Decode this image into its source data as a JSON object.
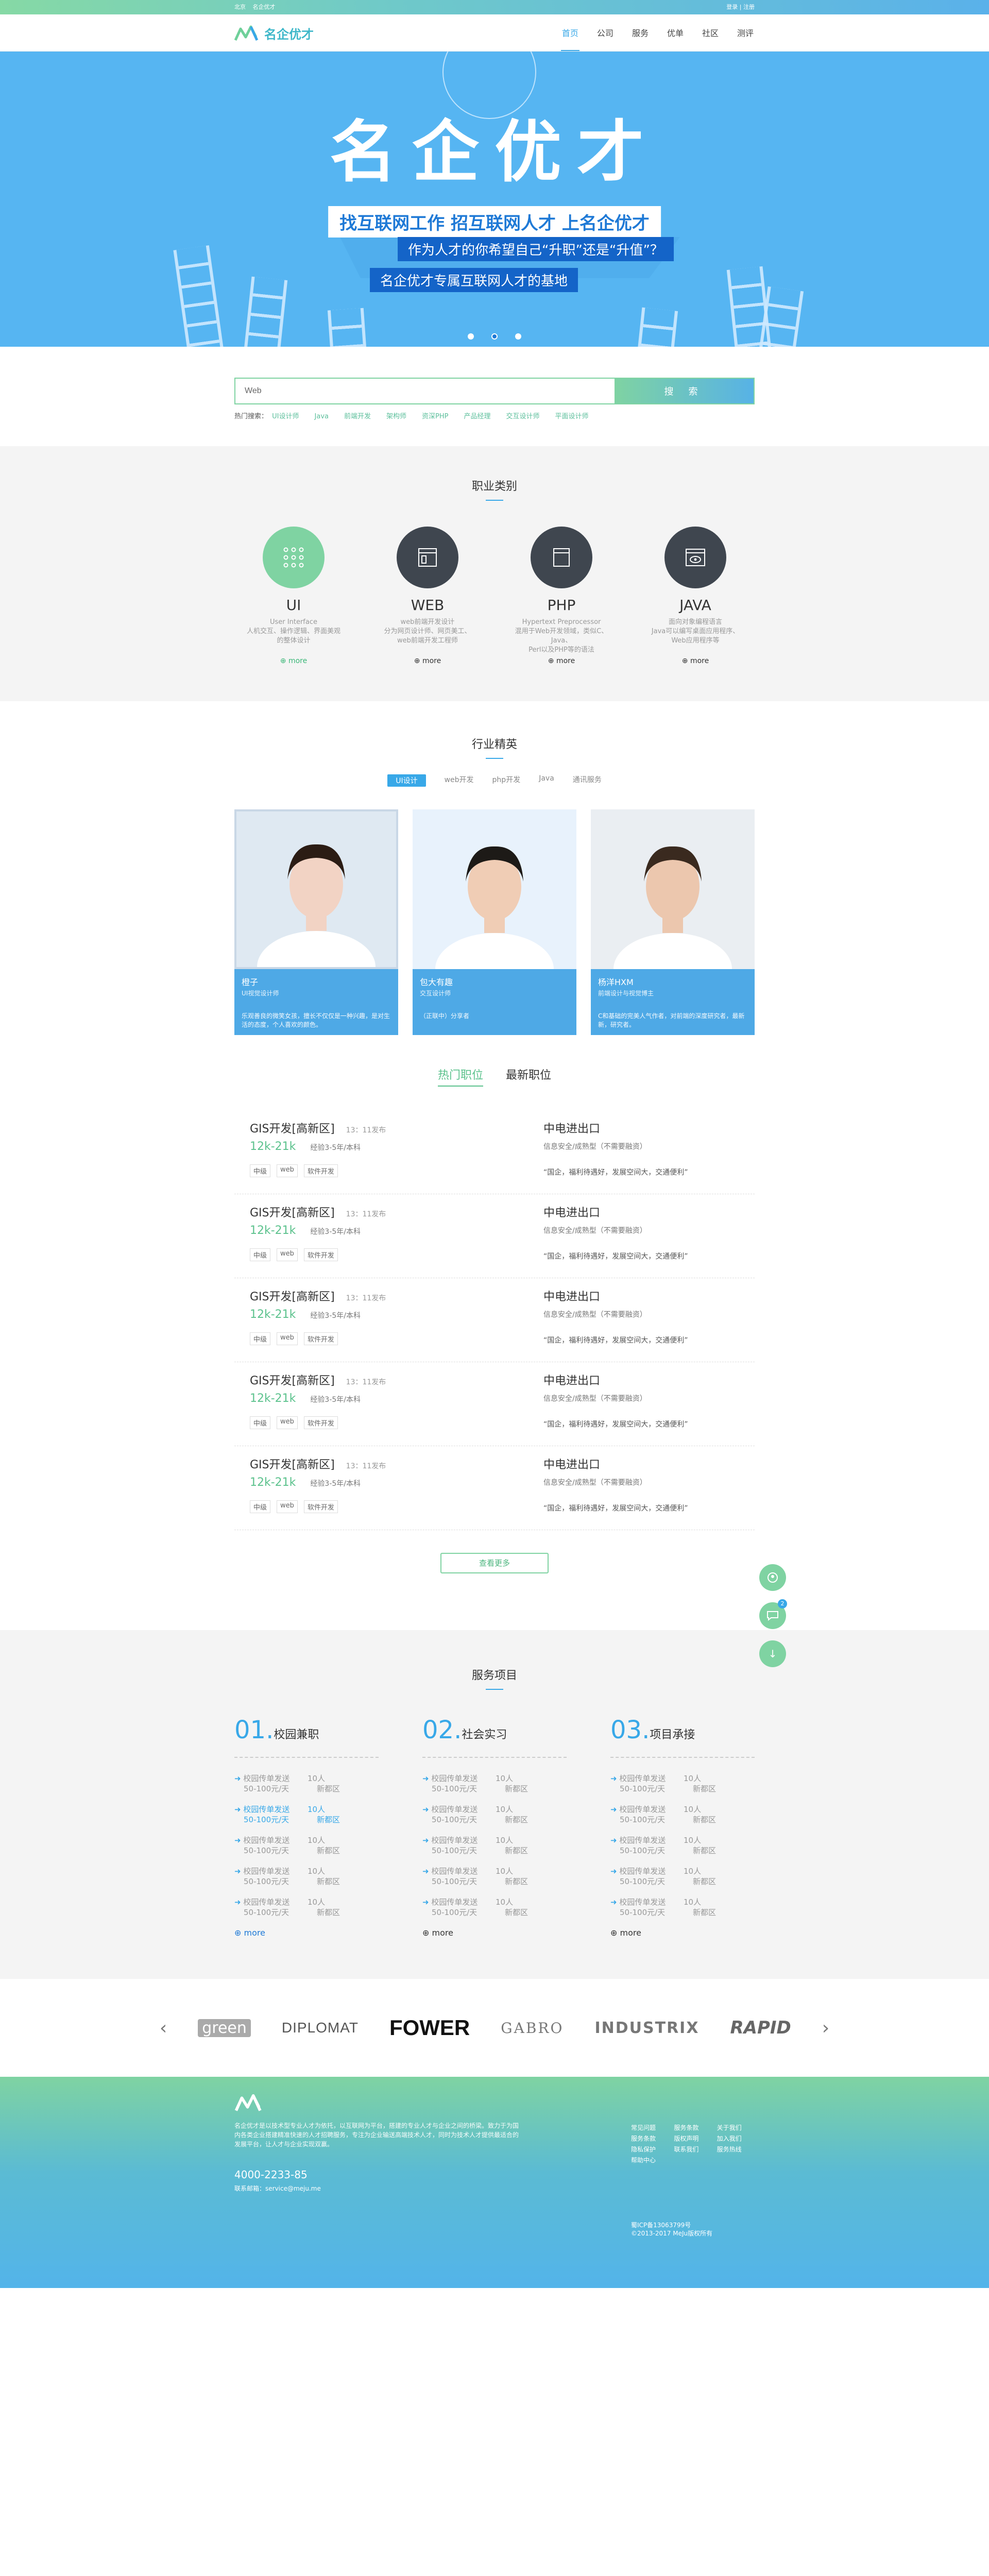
{
  "topbar": {
    "location": "北京",
    "site_tag": "名企优才",
    "login": "登录",
    "separator": "|",
    "register": "注册"
  },
  "header": {
    "logo_text": "名企优才",
    "nav": [
      "首页",
      "公司",
      "服务",
      "优单",
      "社区",
      "测评"
    ],
    "active_nav": "首页"
  },
  "banner": {
    "title": "名企优才",
    "line1": "找互联网工作  招互联网人才  上名企优才",
    "line2": "作为人才的你希望自己“升职”还是“升值”？",
    "line3": "名企优才专属互联网人才的基地",
    "slides": 3,
    "active_slide": 1
  },
  "search": {
    "value": "Web",
    "button": "搜 索",
    "hot_label": "热门搜索：",
    "hot_keywords": [
      "UI设计师",
      "Java",
      "前端开发",
      "架构师",
      "资深PHP",
      "产品经理",
      "交互设计师",
      "平面设计师"
    ]
  },
  "categories": {
    "title": "职业类别",
    "items": [
      {
        "name": "UI",
        "desc": "User Interface\n人机交互、操作逻辑、界面美观\n的整体设计",
        "more": "more",
        "icon": "grid-dots-icon"
      },
      {
        "name": "WEB",
        "desc": "web前端开发设计\n分为网页设计师、网页美工、\nweb前端开发工程师",
        "more": "more",
        "icon": "webpage-icon"
      },
      {
        "name": "PHP",
        "desc": "Hypertext Preprocessor\n混用于Web开发领域，类似C、Java、\nPerl以及PHP等的语法",
        "more": "more",
        "icon": "document-icon"
      },
      {
        "name": "JAVA",
        "desc": "面向对象编程语言\nJava可以编写桌面应用程序、\nWeb应用程序等",
        "more": "more",
        "icon": "eye-browser-icon"
      }
    ]
  },
  "elite": {
    "title": "行业精英",
    "tabs": [
      "UI设计",
      "web开发",
      "php开发",
      "Java",
      "通讯服务"
    ],
    "active_tab": "UI设计",
    "people": [
      {
        "name": "橙子",
        "role": "UI视觉设计师",
        "desc": "乐观善良的微笑女孩，擅长不仅仅是一种兴趣，是对生活的态度，个人喜欢的颜色。"
      },
      {
        "name": "包大有趣",
        "role": "交互设计师",
        "desc": "（正联中）分享者"
      },
      {
        "name": "杨洋HXM",
        "role": "前端设计与视觉博主",
        "desc": "C和基础的完美人气作者，对前端的深度研究者，最新新，研究者。"
      }
    ]
  },
  "jobs": {
    "tabs": [
      "热门职位",
      "最新职位"
    ],
    "active_tab": "热门职位",
    "items": [
      {
        "title": "GIS开发[高新区]",
        "time": "13：11发布",
        "salary": "12k-21k",
        "req": "经验3-5年/本科",
        "tags": [
          "中级",
          "web",
          "软件开发"
        ],
        "company": "中电进出口",
        "industry": "信息安全/成熟型（不需要融资）",
        "slogan": "“国企，福利待遇好，发展空间大，交通便利”"
      },
      {
        "title": "GIS开发[高新区]",
        "time": "13：11发布",
        "salary": "12k-21k",
        "req": "经验3-5年/本科",
        "tags": [
          "中级",
          "web",
          "软件开发"
        ],
        "company": "中电进出口",
        "industry": "信息安全/成熟型（不需要融资）",
        "slogan": "“国企，福利待遇好，发展空间大，交通便利”"
      },
      {
        "title": "GIS开发[高新区]",
        "time": "13：11发布",
        "salary": "12k-21k",
        "req": "经验3-5年/本科",
        "tags": [
          "中级",
          "web",
          "软件开发"
        ],
        "company": "中电进出口",
        "industry": "信息安全/成熟型（不需要融资）",
        "slogan": "“国企，福利待遇好，发展空间大，交通便利”"
      },
      {
        "title": "GIS开发[高新区]",
        "time": "13：11发布",
        "salary": "12k-21k",
        "req": "经验3-5年/本科",
        "tags": [
          "中级",
          "web",
          "软件开发"
        ],
        "company": "中电进出口",
        "industry": "信息安全/成熟型（不需要融资）",
        "slogan": "“国企，福利待遇好，发展空间大，交通便利”"
      },
      {
        "title": "GIS开发[高新区]",
        "time": "13：11发布",
        "salary": "12k-21k",
        "req": "经验3-5年/本科",
        "tags": [
          "中级",
          "web",
          "软件开发"
        ],
        "company": "中电进出口",
        "industry": "信息安全/成熟型（不需要融资）",
        "slogan": "“国企，福利待遇好，发展空间大，交通便利”"
      }
    ],
    "more": "查看更多"
  },
  "side_float": {
    "badge": "2",
    "buttons": [
      "qq-icon",
      "chat-icon",
      "download-icon"
    ],
    "top_label": "↓"
  },
  "services": {
    "title": "服务项目",
    "columns": [
      {
        "num": "01.",
        "name": "校园兼职",
        "items": [
          {
            "a": "校园传单发送",
            "b": "50-100元/天",
            "c": "10人",
            "d": "新都区"
          },
          {
            "a": "校园传单发送",
            "b": "50-100元/天",
            "c": "10人",
            "d": "新都区",
            "hl": true
          },
          {
            "a": "校园传单发送",
            "b": "50-100元/天",
            "c": "10人",
            "d": "新都区"
          },
          {
            "a": "校园传单发送",
            "b": "50-100元/天",
            "c": "10人",
            "d": "新都区"
          },
          {
            "a": "校园传单发送",
            "b": "50-100元/天",
            "c": "10人",
            "d": "新都区"
          }
        ],
        "more": "more"
      },
      {
        "num": "02.",
        "name": "社会实习",
        "items": [
          {
            "a": "校园传单发送",
            "b": "50-100元/天",
            "c": "10人",
            "d": "新都区"
          },
          {
            "a": "校园传单发送",
            "b": "50-100元/天",
            "c": "10人",
            "d": "新都区"
          },
          {
            "a": "校园传单发送",
            "b": "50-100元/天",
            "c": "10人",
            "d": "新都区"
          },
          {
            "a": "校园传单发送",
            "b": "50-100元/天",
            "c": "10人",
            "d": "新都区"
          },
          {
            "a": "校园传单发送",
            "b": "50-100元/天",
            "c": "10人",
            "d": "新都区"
          }
        ],
        "more": "more"
      },
      {
        "num": "03.",
        "name": "项目承接",
        "items": [
          {
            "a": "校园传单发送",
            "b": "50-100元/天",
            "c": "10人",
            "d": "新都区"
          },
          {
            "a": "校园传单发送",
            "b": "50-100元/天",
            "c": "10人",
            "d": "新都区"
          },
          {
            "a": "校园传单发送",
            "b": "50-100元/天",
            "c": "10人",
            "d": "新都区"
          },
          {
            "a": "校园传单发送",
            "b": "50-100元/天",
            "c": "10人",
            "d": "新都区"
          },
          {
            "a": "校园传单发送",
            "b": "50-100元/天",
            "c": "10人",
            "d": "新都区"
          }
        ],
        "more": "more"
      }
    ]
  },
  "partners": [
    "green",
    "DIPLOMAT",
    "FOWER",
    "GABRO",
    "INDUSTRIX",
    "RAPID"
  ],
  "footer": {
    "intro": "名企优才是以技术型专业人才为依托，以互联网为平台，搭建的专业人才与企业之间的桥梁。致力于为国内各类企业搭建精准快速的人才招聘服务，专注为企业输送高端技术人才，同时为技术人才提供最适合的发展平台，让人才与企业实现双赢。",
    "tel": "4000-2233-85",
    "email": "联系邮箱：service@meju.me",
    "links": [
      "常见问题",
      "服务条款",
      "关于我们",
      "服务条款",
      "版权声明",
      "加入我们",
      "隐私保护",
      "联系我们",
      "服务热线",
      "帮助中心"
    ],
    "icp": "蜀ICP备13063799号",
    "copyright": "©2013-2017 MeJu版权所有"
  }
}
